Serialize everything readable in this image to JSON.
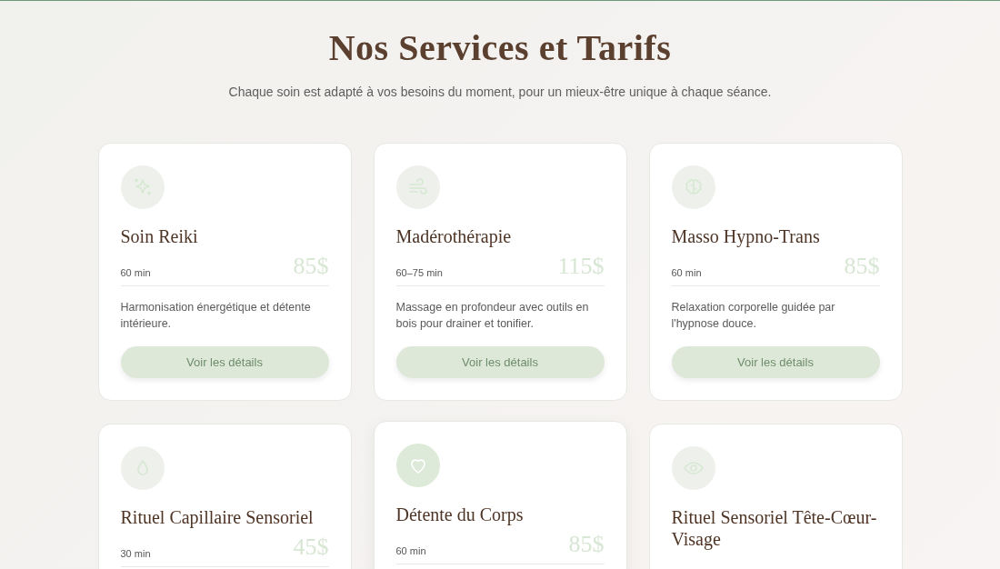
{
  "header": {
    "title": "Nos Services et Tarifs",
    "subtitle": "Chaque soin est adapté à vos besoins du moment, pour un mieux-être unique à chaque séance."
  },
  "services": [
    {
      "kind": "sparkles",
      "name": "Soin Reiki",
      "duration": "60 min",
      "price": "85$",
      "description": "Harmonisation énergétique et détente intérieure.",
      "button": "Voir les détails",
      "hovered": false
    },
    {
      "kind": "wind",
      "name": "Madérothérapie",
      "duration": "60–75 min",
      "price": "115$",
      "description": "Massage en profondeur avec outils en bois pour drainer et tonifier.",
      "button": "Voir les détails",
      "hovered": false
    },
    {
      "kind": "brain",
      "name": "Masso Hypno-Trans",
      "duration": "60 min",
      "price": "85$",
      "description": "Relaxation corporelle guidée par l'hypnose douce.",
      "button": "Voir les détails",
      "hovered": false
    },
    {
      "kind": "droplet",
      "name": "Rituel Capillaire Sensoriel",
      "duration": "30 min",
      "price": "45$",
      "hovered": false
    },
    {
      "kind": "heart",
      "name": "Détente du Corps",
      "duration": "60 min",
      "price": "85$",
      "hovered": true
    },
    {
      "kind": "eye",
      "name": "Rituel Sensoriel Tête-Cœur-Visage",
      "hovered": false
    }
  ]
}
